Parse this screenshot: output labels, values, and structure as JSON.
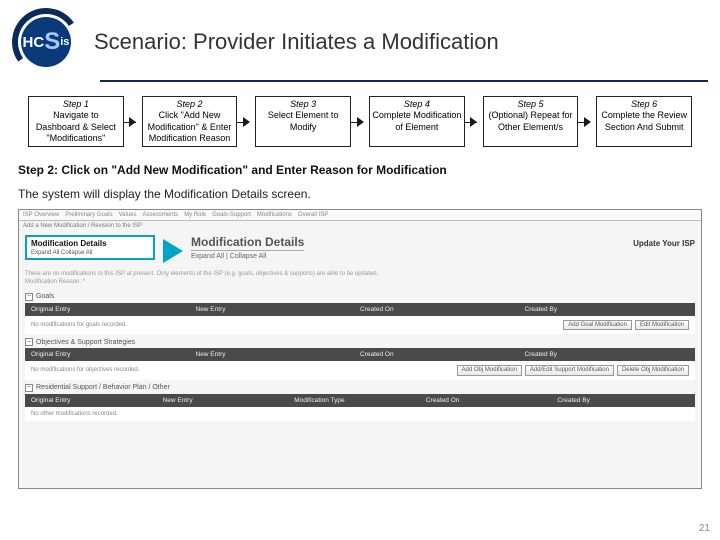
{
  "logo": {
    "text_h": "H",
    "text_c": "C",
    "text_s": "S",
    "text_is": "is"
  },
  "title": "Scenario: Provider Initiates a Modification",
  "steps": [
    {
      "num": "Step 1",
      "text": "Navigate to Dashboard & Select \"Modifications\""
    },
    {
      "num": "Step 2",
      "text": "Click \"Add New Modification\" & Enter Modification Reason"
    },
    {
      "num": "Step 3",
      "text": "Select Element to Modify"
    },
    {
      "num": "Step 4",
      "text": "Complete Modification of Element"
    },
    {
      "num": "Step 5",
      "text": "(Optional) Repeat for Other Element/s"
    },
    {
      "num": "Step 6",
      "text": "Complete the Review Section And Submit"
    }
  ],
  "subtitle": "Step 2: Click on \"Add New Modification\" and Enter Reason for Modification",
  "description": "The system will display the Modification Details screen.",
  "screenshot": {
    "tabs": [
      "ISP Overview",
      "Preliminary Goals",
      "Values",
      "Assessments",
      "My Role",
      "Goals-Support",
      "Modifications",
      "Overall ISP"
    ],
    "subtab": "Add a New Modification / Revision to the ISP",
    "left_panel": {
      "title": "Modification Details",
      "links": "Expand All   Collapse All"
    },
    "main_header": {
      "title": "Modification Details",
      "expand": "Expand All | Collapse All",
      "action": "Update Your ISP"
    },
    "desc_line1": "There are no modifications to this ISP at present. Only elements of the ISP (e.g. goals, objectives & supports) are able to be updated.",
    "desc_line2": "Modification Reason: *",
    "sections": [
      {
        "label": "Goals",
        "columns": [
          "Original Entry",
          "New Entry",
          "Created On",
          "Created By"
        ],
        "empty_text": "No modifications for goals recorded.",
        "buttons": [
          "Add\nGoal Modification",
          "Edit Modification"
        ]
      },
      {
        "label": "Objectives & Support Strategies",
        "columns": [
          "Original Entry",
          "New Entry",
          "Created On",
          "Created By"
        ],
        "empty_text": "No modifications for objectives recorded.",
        "buttons": [
          "Add\nObj Modification",
          "Add/Edit\nSupport Modification",
          "Delete\nObj Modification"
        ]
      },
      {
        "label": "Residential Support / Behavior Plan / Other",
        "columns": [
          "Original Entry",
          "New Entry",
          "Modification Type",
          "Created On",
          "Created By"
        ],
        "empty_text": "No other modifications recorded."
      }
    ]
  },
  "page_number": "21"
}
